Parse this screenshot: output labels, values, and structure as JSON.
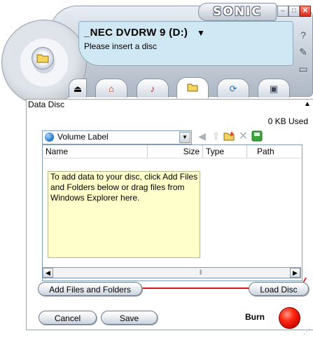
{
  "window": {
    "brand": "SONIC",
    "controls": {
      "minimize": "–",
      "maximize": "□",
      "close": "✕"
    }
  },
  "drive": {
    "name": "_NEC DVDRW 9 (D:)",
    "dropdown_glyph": "▼",
    "status": "Please insert a disc"
  },
  "side_icons": [
    "help-icon",
    "tools-icon",
    "folder-icon"
  ],
  "tabs": [
    {
      "name": "eject-tab",
      "glyph": "⏏"
    },
    {
      "name": "home-tab",
      "glyph": "⌂"
    },
    {
      "name": "audio-tab",
      "glyph": "♪"
    },
    {
      "name": "data-tab",
      "glyph": "📂",
      "active": true
    },
    {
      "name": "copy-tab",
      "glyph": "⟳"
    },
    {
      "name": "video-tab",
      "glyph": "▣"
    }
  ],
  "section": {
    "title": "Data Disc",
    "collapse_glyph": "▲"
  },
  "usage": "0 KB Used",
  "volume": {
    "label": "Volume Label"
  },
  "toolbar_icons": [
    "back-arrow-icon",
    "up-folder-icon",
    "new-folder-icon",
    "delete-icon",
    "save-icon"
  ],
  "columns": [
    "Name",
    "Size",
    "Type",
    "Path"
  ],
  "hint": "To add data to your disc, click Add Files and Folders below or drag files from Windows Explorer here.",
  "buttons": {
    "add_files": "Add Files and Folders",
    "load_disc": "Load Disc",
    "cancel": "Cancel",
    "save": "Save",
    "burn": "Burn"
  },
  "colors": {
    "accent_red": "#d81616",
    "panel_blue": "#cfe8f3",
    "hint_bg": "#ffffcc"
  }
}
